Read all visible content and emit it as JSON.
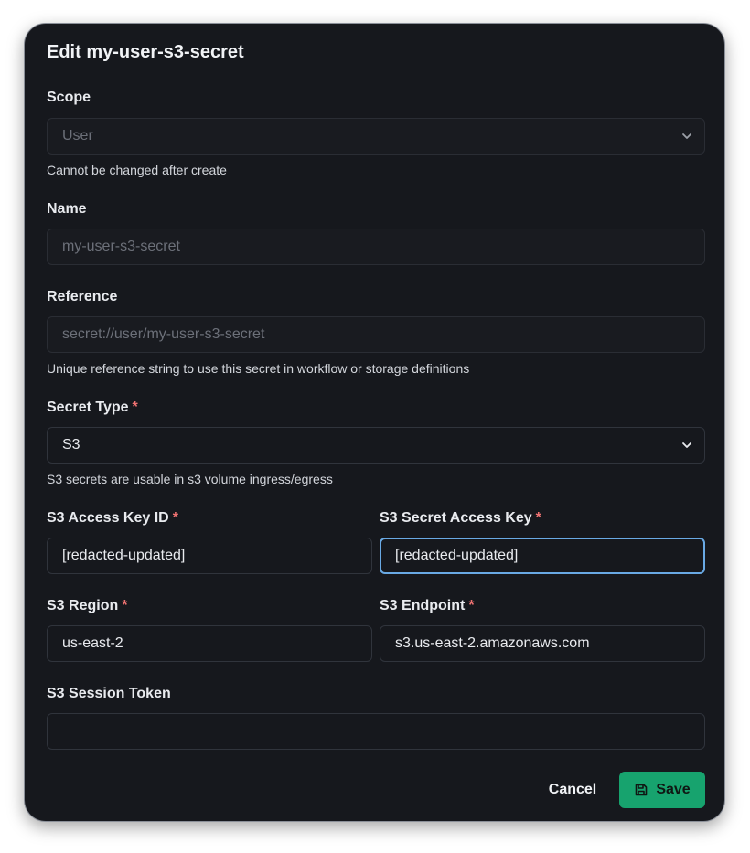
{
  "dialog": {
    "title": "Edit my-user-s3-secret"
  },
  "scope": {
    "label": "Scope",
    "value": "User",
    "help": "Cannot be changed after create"
  },
  "name": {
    "label": "Name",
    "value": "my-user-s3-secret"
  },
  "reference": {
    "label": "Reference",
    "value": "secret://user/my-user-s3-secret",
    "help": "Unique reference string to use this secret in workflow or storage definitions"
  },
  "secret_type": {
    "label": "Secret Type",
    "required_mark": "*",
    "value": "S3",
    "help": "S3 secrets are usable in s3 volume ingress/egress"
  },
  "access_key_id": {
    "label": "S3 Access Key ID",
    "required_mark": "*",
    "value": "[redacted-updated]"
  },
  "secret_access_key": {
    "label": "S3 Secret Access Key",
    "required_mark": "*",
    "value": "[redacted-updated]"
  },
  "region": {
    "label": "S3 Region",
    "required_mark": "*",
    "value": "us-east-2"
  },
  "endpoint": {
    "label": "S3 Endpoint",
    "required_mark": "*",
    "value": "s3.us-east-2.amazonaws.com"
  },
  "session_token": {
    "label": "S3 Session Token",
    "value": ""
  },
  "actions": {
    "cancel_label": "Cancel",
    "save_label": "Save",
    "save_icon": "save-icon"
  },
  "colors": {
    "accent": "#17a36e",
    "focus": "#69a9e4",
    "required": "#f07272",
    "background": "#16181d"
  }
}
